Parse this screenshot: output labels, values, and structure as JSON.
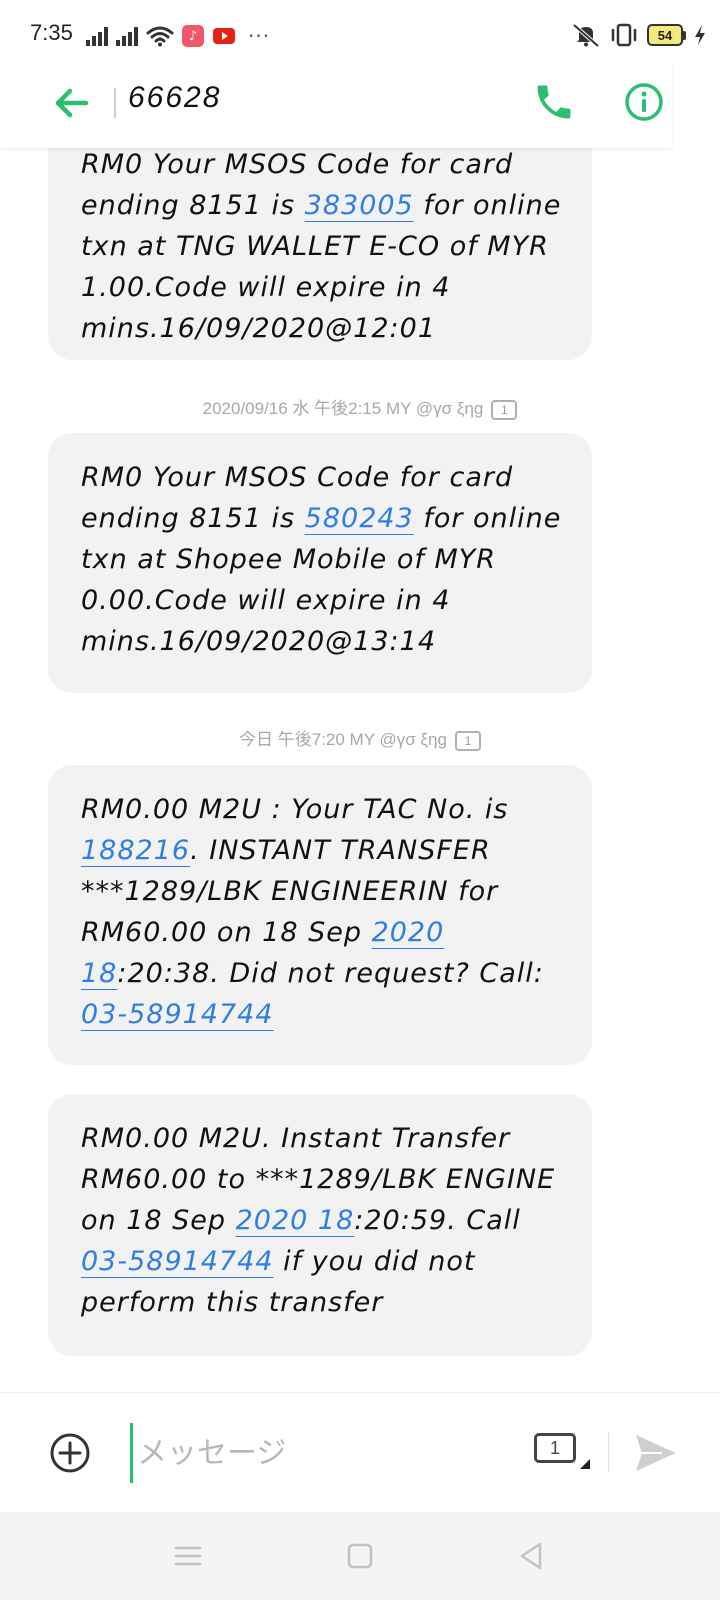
{
  "status_bar": {
    "time": "7:35",
    "battery_level": "54",
    "more_indicator": "···",
    "icons": [
      "signal-1-icon",
      "signal-2-icon",
      "wifi-icon",
      "music-app-icon",
      "youtube-app-icon",
      "mute-vibrate-icon",
      "vibrate-icon",
      "battery-icon",
      "charging-icon"
    ]
  },
  "header": {
    "contact": "66628",
    "accent_color": "#2cbf72"
  },
  "conversation": {
    "messages": [
      {
        "parts": [
          {
            "text": "RM0 Your MSOS Code for card ending 8151 is "
          },
          {
            "text": "383005",
            "link": true
          },
          {
            "text": " for online txn at TNG WALLET E-CO of MYR 1.00.Code will expire in 4 mins.16/09/2020@12:01"
          }
        ]
      },
      {
        "timestamp": "2020/09/16 水 午後2:15  MY @γσ ξηg",
        "sim": "1",
        "parts": [
          {
            "text": "RM0 Your MSOS Code for card ending 8151 is "
          },
          {
            "text": "580243",
            "link": true
          },
          {
            "text": " for online txn at Shopee Mobile of MYR 0.00.Code will expire in 4 mins.16/09/2020@13:14"
          }
        ]
      },
      {
        "timestamp": "今日 午後7:20  MY @γσ ξηg",
        "sim": "1",
        "parts": [
          {
            "text": "RM0.00 M2U : Your TAC No. is "
          },
          {
            "text": "188216",
            "link": true
          },
          {
            "text": ". INSTANT TRANSFER ***1289/LBK ENGINEERIN for RM60.00 on 18 Sep "
          },
          {
            "text": "2020 18",
            "link": true
          },
          {
            "text": ":20:38. Did not request? Call: "
          },
          {
            "text": "03-58914744",
            "link": true
          }
        ]
      },
      {
        "parts": [
          {
            "text": "RM0.00 M2U. Instant Transfer RM60.00 to  ***1289/LBK ENGINE on 18 Sep "
          },
          {
            "text": "2020 18",
            "link": true
          },
          {
            "text": ":20:59. Call "
          },
          {
            "text": "03-58914744",
            "link": true
          },
          {
            "text": " if you did not perform this transfer"
          }
        ]
      }
    ],
    "link_color": "#2f7fe3",
    "bubble_color": "#f2f2f2"
  },
  "composer": {
    "placeholder": "メッセージ",
    "sim_label": "1"
  },
  "nav_bar": {
    "buttons": [
      "menu-icon",
      "home-icon",
      "back-icon"
    ]
  }
}
